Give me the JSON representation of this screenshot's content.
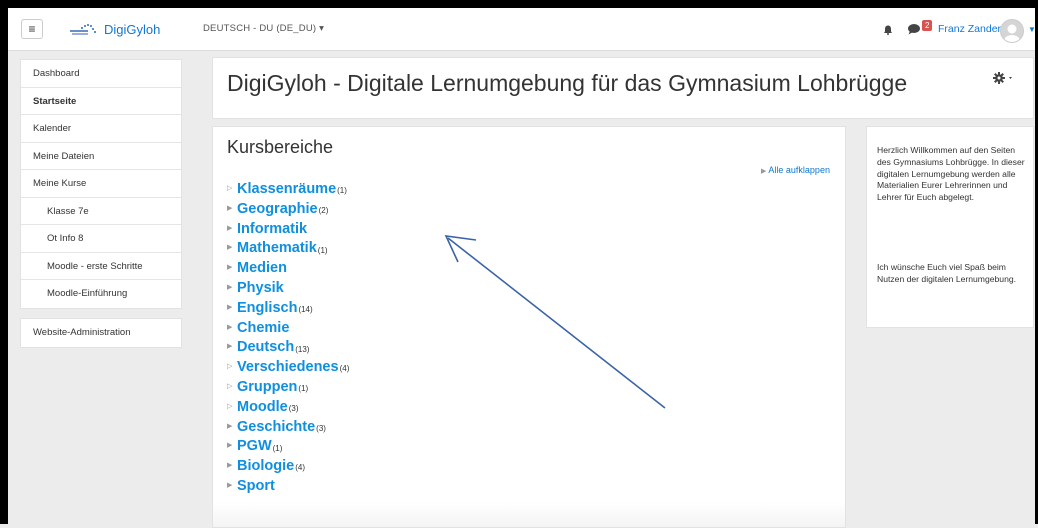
{
  "navbar": {
    "menu_icon": "hamburger-icon",
    "brand": "DigiGyloh",
    "language": "DEUTSCH - DU (DE_DU) ▾",
    "notification_icon": "bell-icon",
    "message_icon": "chat-icon",
    "message_count": "2",
    "user_name": "Franz Zander",
    "user_menu_icon": "chevron-down-icon"
  },
  "sidebar": {
    "main": [
      "Dashboard",
      "Startseite",
      "Kalender",
      "Meine Dateien",
      "Meine Kurse",
      "Klasse 7e",
      "Ot Info 8",
      "Moodle - erste Schritte",
      "Moodle-Einführung"
    ],
    "admin": "Website-Administration"
  },
  "header": {
    "title": "DigiGyloh - Digitale Lernumgebung für das Gymnasium Lohbrügge",
    "settings_icon": "gear-icon"
  },
  "main": {
    "section_title": "Kursbereiche",
    "expand_all": "Alle aufklappen",
    "categories": [
      {
        "name": "Klassenräume",
        "count": "(1)"
      },
      {
        "name": "Geographie",
        "count": "(2)"
      },
      {
        "name": "Informatik",
        "count": ""
      },
      {
        "name": "Mathematik",
        "count": "(1)"
      },
      {
        "name": "Medien",
        "count": ""
      },
      {
        "name": "Physik",
        "count": ""
      },
      {
        "name": "Englisch",
        "count": "(14)"
      },
      {
        "name": "Chemie",
        "count": ""
      },
      {
        "name": "Deutsch",
        "count": "(13)"
      },
      {
        "name": "Verschiedenes",
        "count": "(4)"
      },
      {
        "name": "Gruppen",
        "count": "(1)"
      },
      {
        "name": "Moodle",
        "count": "(3)"
      },
      {
        "name": "Geschichte",
        "count": "(3)"
      },
      {
        "name": "PGW",
        "count": "(1)"
      },
      {
        "name": "Biologie",
        "count": "(4)"
      },
      {
        "name": "Sport",
        "count": ""
      }
    ]
  },
  "side_block": {
    "paragraph1": "Herzlich Willkommen auf den Seiten des Gymnasiums Lohbrügge. In dieser digitalen Lernumgebung werden alle Materialien Eurer Lehrerinnen und Lehrer für Euch abgelegt.",
    "paragraph2": "Ich wünsche Euch viel Spaß beim Nutzen der digitalen Lernumgebung."
  },
  "colors": {
    "link": "#1177d1",
    "category": "#0f8fde",
    "arrow": "#3a63a8"
  }
}
